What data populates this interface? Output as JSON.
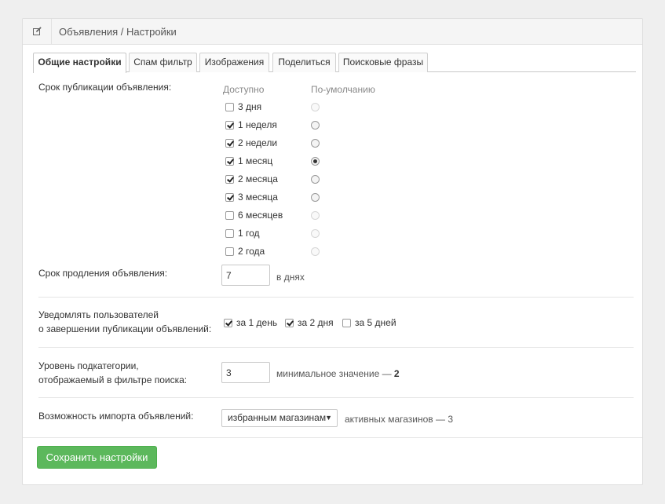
{
  "header": {
    "icon": "edit-icon",
    "title": "Объявления / Настройки"
  },
  "tabs": [
    {
      "label": "Общие настройки",
      "active": true
    },
    {
      "label": "Спам фильтр",
      "active": false
    },
    {
      "label": "Изображения",
      "active": false
    },
    {
      "label": "Поделиться",
      "active": false
    },
    {
      "label": "Поисковые фразы",
      "active": false
    }
  ],
  "publication": {
    "label": "Срок публикации объявления:",
    "col_available": "Доступно",
    "col_default": "По-умолчанию",
    "options": [
      {
        "label": "3 дня",
        "available": false,
        "default": false
      },
      {
        "label": "1 неделя",
        "available": true,
        "default": false
      },
      {
        "label": "2 недели",
        "available": true,
        "default": false
      },
      {
        "label": "1 месяц",
        "available": true,
        "default": true
      },
      {
        "label": "2 месяца",
        "available": true,
        "default": false
      },
      {
        "label": "3 месяца",
        "available": true,
        "default": false
      },
      {
        "label": "6 месяцев",
        "available": false,
        "default": false
      },
      {
        "label": "1 год",
        "available": false,
        "default": false
      },
      {
        "label": "2 года",
        "available": false,
        "default": false
      }
    ]
  },
  "extension": {
    "label": "Срок продления объявления:",
    "value": "7",
    "unit": "в днях"
  },
  "notify": {
    "label_line1": "Уведомлять пользователей",
    "label_line2": "о завершении публикации объявлений:",
    "options": [
      {
        "label": "за 1 день",
        "checked": true
      },
      {
        "label": "за 2 дня",
        "checked": true
      },
      {
        "label": "за 5 дней",
        "checked": false
      }
    ]
  },
  "subcategory": {
    "label_line1": "Уровень подкатегории,",
    "label_line2": "отображаемый в фильтре поиска:",
    "value": "3",
    "hint_text": "минимальное значение —",
    "hint_value": "2"
  },
  "import": {
    "label": "Возможность импорта объявлений:",
    "selected": "избранным магазинам",
    "hint_text": "активных магазинов —",
    "hint_value": "3"
  },
  "save_label": "Сохранить настройки",
  "colors": {
    "accent_green": "#5cb85c",
    "background": "#efefef"
  }
}
